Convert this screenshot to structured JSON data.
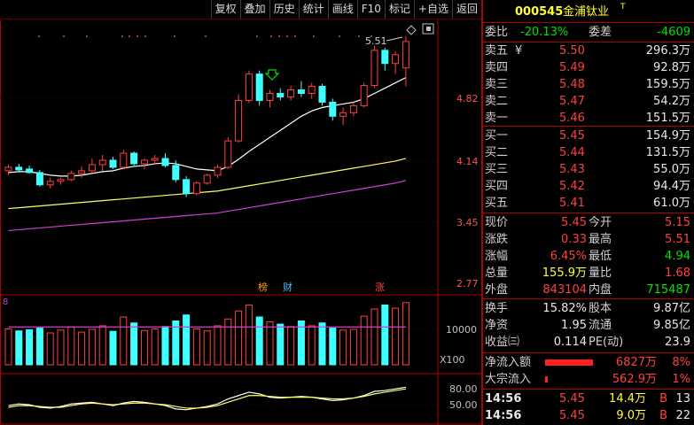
{
  "toolbar": {
    "items": [
      "复权",
      "叠加",
      "历史",
      "统计",
      "画线",
      "F10",
      "标记",
      "+自选",
      "返回"
    ]
  },
  "chart": {
    "price_labels": [
      "4.82",
      "4.14",
      "3.45",
      "2.77"
    ],
    "volume_labels": [
      "10000",
      "X100"
    ],
    "indicator_labels": [
      "80.00",
      "50.00"
    ],
    "high_annotation": "5.51",
    "tags": [
      "榜",
      "财",
      "涨"
    ],
    "volume_tag": "8"
  },
  "chart_data": {
    "type": "candlestick",
    "candles": [
      {
        "o": 3.98,
        "h": 4.05,
        "l": 3.93,
        "c": 4.02
      },
      {
        "o": 4.02,
        "h": 4.06,
        "l": 3.96,
        "c": 3.99
      },
      {
        "o": 4.0,
        "h": 4.04,
        "l": 3.95,
        "c": 3.96
      },
      {
        "o": 3.96,
        "h": 3.99,
        "l": 3.8,
        "c": 3.82
      },
      {
        "o": 3.82,
        "h": 3.9,
        "l": 3.78,
        "c": 3.86
      },
      {
        "o": 3.86,
        "h": 3.9,
        "l": 3.82,
        "c": 3.88
      },
      {
        "o": 3.88,
        "h": 3.98,
        "l": 3.86,
        "c": 3.95
      },
      {
        "o": 3.95,
        "h": 4.03,
        "l": 3.9,
        "c": 3.98
      },
      {
        "o": 3.98,
        "h": 4.12,
        "l": 3.95,
        "c": 4.05
      },
      {
        "o": 4.05,
        "h": 4.16,
        "l": 3.98,
        "c": 4.1
      },
      {
        "o": 4.1,
        "h": 4.14,
        "l": 4.0,
        "c": 4.02
      },
      {
        "o": 4.02,
        "h": 4.22,
        "l": 4.0,
        "c": 4.18
      },
      {
        "o": 4.18,
        "h": 4.2,
        "l": 4.04,
        "c": 4.06
      },
      {
        "o": 4.06,
        "h": 4.12,
        "l": 4.0,
        "c": 4.1
      },
      {
        "o": 4.1,
        "h": 4.16,
        "l": 4.06,
        "c": 4.12
      },
      {
        "o": 4.12,
        "h": 4.18,
        "l": 4.02,
        "c": 4.04
      },
      {
        "o": 4.04,
        "h": 4.1,
        "l": 3.85,
        "c": 3.88
      },
      {
        "o": 3.88,
        "h": 3.92,
        "l": 3.68,
        "c": 3.72
      },
      {
        "o": 3.72,
        "h": 3.86,
        "l": 3.7,
        "c": 3.84
      },
      {
        "o": 3.84,
        "h": 3.95,
        "l": 3.82,
        "c": 3.93
      },
      {
        "o": 3.93,
        "h": 4.05,
        "l": 3.9,
        "c": 4.02
      },
      {
        "o": 4.02,
        "h": 4.36,
        "l": 4.0,
        "c": 4.32
      },
      {
        "o": 4.32,
        "h": 4.85,
        "l": 4.3,
        "c": 4.78
      },
      {
        "o": 4.78,
        "h": 5.12,
        "l": 4.75,
        "c": 5.08
      },
      {
        "o": 5.08,
        "h": 5.12,
        "l": 4.72,
        "c": 4.78
      },
      {
        "o": 4.78,
        "h": 4.9,
        "l": 4.7,
        "c": 4.86
      },
      {
        "o": 4.86,
        "h": 4.92,
        "l": 4.78,
        "c": 4.82
      },
      {
        "o": 4.82,
        "h": 4.95,
        "l": 4.78,
        "c": 4.9
      },
      {
        "o": 4.9,
        "h": 5.0,
        "l": 4.82,
        "c": 4.86
      },
      {
        "o": 4.86,
        "h": 4.98,
        "l": 4.8,
        "c": 4.94
      },
      {
        "o": 4.94,
        "h": 4.97,
        "l": 4.72,
        "c": 4.76
      },
      {
        "o": 4.76,
        "h": 4.8,
        "l": 4.55,
        "c": 4.6
      },
      {
        "o": 4.6,
        "h": 4.7,
        "l": 4.5,
        "c": 4.64
      },
      {
        "o": 4.64,
        "h": 4.76,
        "l": 4.6,
        "c": 4.72
      },
      {
        "o": 4.72,
        "h": 4.98,
        "l": 4.7,
        "c": 4.95
      },
      {
        "o": 4.95,
        "h": 5.4,
        "l": 4.92,
        "c": 5.35
      },
      {
        "o": 5.35,
        "h": 5.38,
        "l": 5.12,
        "c": 5.2
      },
      {
        "o": 5.2,
        "h": 5.34,
        "l": 5.08,
        "c": 5.3
      },
      {
        "o": 5.15,
        "h": 5.51,
        "l": 4.94,
        "c": 5.45
      }
    ],
    "ma_short": [
      3.96,
      3.97,
      3.97,
      3.95,
      3.93,
      3.92,
      3.92,
      3.93,
      3.95,
      3.97,
      3.98,
      4.01,
      4.03,
      4.04,
      4.06,
      4.07,
      4.06,
      4.03,
      4.0,
      3.99,
      3.98,
      4.03,
      4.11,
      4.2,
      4.28,
      4.36,
      4.44,
      4.52,
      4.6,
      4.66,
      4.7,
      4.72,
      4.74,
      4.76,
      4.8,
      4.86,
      4.92,
      4.98,
      5.04
    ],
    "ma_mid": [
      3.55,
      3.56,
      3.57,
      3.58,
      3.59,
      3.6,
      3.61,
      3.62,
      3.63,
      3.64,
      3.65,
      3.66,
      3.67,
      3.68,
      3.69,
      3.7,
      3.71,
      3.72,
      3.73,
      3.74,
      3.75,
      3.77,
      3.79,
      3.81,
      3.83,
      3.85,
      3.87,
      3.89,
      3.91,
      3.93,
      3.95,
      3.97,
      3.99,
      4.01,
      4.03,
      4.05,
      4.07,
      4.09,
      4.12
    ],
    "ma_long": [
      3.3,
      3.31,
      3.32,
      3.33,
      3.34,
      3.35,
      3.36,
      3.37,
      3.38,
      3.39,
      3.4,
      3.41,
      3.42,
      3.43,
      3.44,
      3.45,
      3.46,
      3.47,
      3.48,
      3.49,
      3.5,
      3.52,
      3.54,
      3.56,
      3.58,
      3.6,
      3.62,
      3.64,
      3.66,
      3.68,
      3.7,
      3.72,
      3.74,
      3.76,
      3.78,
      3.8,
      3.82,
      3.84,
      3.87
    ],
    "volumes": [
      9000,
      8500,
      8800,
      9200,
      8000,
      8700,
      9500,
      8200,
      8900,
      9800,
      8400,
      12000,
      10500,
      8600,
      9000,
      9600,
      11000,
      12500,
      9000,
      8500,
      9800,
      11500,
      13500,
      15000,
      12000,
      10800,
      10200,
      9600,
      11000,
      9800,
      10500,
      9200,
      8700,
      8900,
      12200,
      14000,
      15000,
      14200,
      15590
    ],
    "vol_ma": [
      9500,
      9500,
      9500,
      9500,
      9500,
      9500,
      9500,
      9500,
      9500,
      9500,
      9500,
      9500,
      9500,
      9500,
      9500,
      9500,
      9500,
      9500,
      9500,
      9500,
      9500,
      9500,
      9500,
      9500,
      9500,
      9500,
      9500,
      9500,
      9500,
      9500,
      9500,
      9500,
      9500,
      9500,
      9500,
      9500,
      9500,
      9500,
      9500
    ],
    "price_axis": [
      2.7,
      5.6
    ],
    "volume_axis": [
      0,
      16000
    ],
    "kdj_white": [
      60,
      62,
      61,
      58,
      57,
      59,
      62,
      63,
      64,
      62,
      60,
      63,
      65,
      64,
      62,
      60,
      56,
      55,
      57,
      59,
      62,
      68,
      72,
      76,
      74,
      70,
      69,
      70,
      71,
      70,
      68,
      66,
      67,
      69,
      72,
      77,
      78,
      80,
      82
    ],
    "kdj_yellow": [
      58,
      60,
      60,
      59,
      58,
      58,
      60,
      62,
      63,
      62,
      61,
      62,
      63,
      63,
      62,
      61,
      59,
      57,
      57,
      58,
      60,
      64,
      68,
      72,
      72,
      71,
      70,
      70,
      70,
      70,
      69,
      68,
      68,
      69,
      71,
      74,
      76,
      78,
      80
    ],
    "indicator_axis": [
      40,
      95
    ]
  },
  "panel": {
    "stock_code": "000545",
    "stock_name": "金浦钛业",
    "name_mark": "T",
    "weibi_label": "委比",
    "weibi_value": "-20.13%",
    "weicha_label": "委差",
    "weicha_value": "-4609",
    "asks": [
      {
        "label": "卖五",
        "mark": "¥",
        "price": "5.50",
        "vol": "296.3万"
      },
      {
        "label": "卖四",
        "mark": "",
        "price": "5.49",
        "vol": "92.8万"
      },
      {
        "label": "卖三",
        "mark": "",
        "price": "5.48",
        "vol": "159.5万"
      },
      {
        "label": "卖二",
        "mark": "",
        "price": "5.47",
        "vol": "54.2万"
      },
      {
        "label": "卖一",
        "mark": "",
        "price": "5.46",
        "vol": "151.5万"
      }
    ],
    "bids": [
      {
        "label": "买一",
        "price": "5.45",
        "vol": "154.9万"
      },
      {
        "label": "买二",
        "price": "5.44",
        "vol": "131.5万"
      },
      {
        "label": "买三",
        "price": "5.43",
        "vol": "55.0万"
      },
      {
        "label": "买四",
        "price": "5.42",
        "vol": "94.4万"
      },
      {
        "label": "买五",
        "price": "5.41",
        "vol": "61.0万"
      }
    ],
    "quote": [
      {
        "l1": "现价",
        "v1": "5.45",
        "l2": "今开",
        "v2": "5.15"
      },
      {
        "l1": "涨跌",
        "v1": "0.33",
        "l2": "最高",
        "v2": "5.51"
      },
      {
        "l1": "涨幅",
        "v1": "6.45%",
        "l2": "最低",
        "v2": "4.94"
      },
      {
        "l1": "总量",
        "v1": "155.9万",
        "l2": "量比",
        "v2": "1.68"
      },
      {
        "l1": "外盘",
        "v1": "843104",
        "l2": "内盘",
        "v2": "715487"
      }
    ],
    "fund": [
      {
        "l1": "换手",
        "v1": "15.82%",
        "l2": "股本",
        "v2": "9.87亿"
      },
      {
        "l1": "净资",
        "v1": "1.95",
        "l2": "流通",
        "v2": "9.85亿"
      },
      {
        "l1": "收益㈢",
        "v1": "0.114",
        "l2": "PE(动)",
        "v2": "23.9"
      }
    ],
    "flow": [
      {
        "label": "净流入额",
        "amount": "6827万",
        "pct": "8%",
        "bar_fraction": 0.9
      },
      {
        "label": "大宗流入",
        "amount": "562.9万",
        "pct": "1%",
        "bar_fraction": 0.03
      }
    ],
    "ticks": [
      {
        "time": "14:56",
        "price": "5.45",
        "vol": "14.4万",
        "side": "B",
        "n": "13"
      },
      {
        "time": "14:56",
        "price": "5.45",
        "vol": "9.0万",
        "side": "B",
        "n": "22"
      }
    ]
  }
}
